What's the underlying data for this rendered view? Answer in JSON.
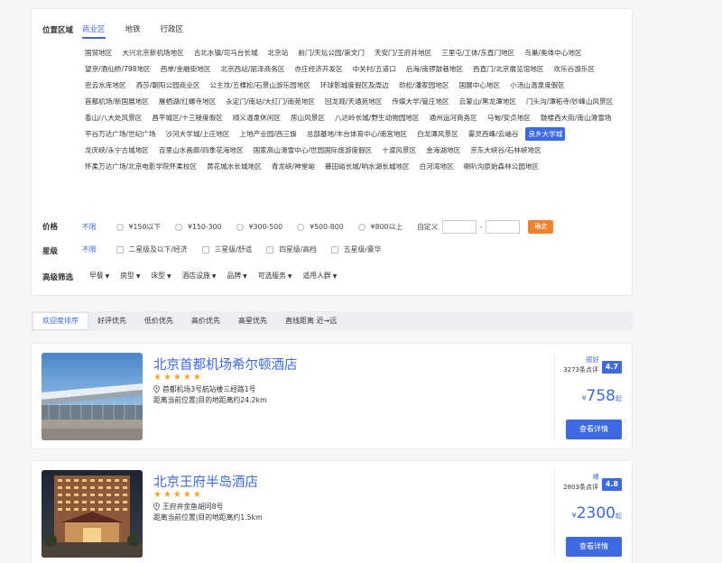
{
  "filters": {
    "location_label": "位置区域",
    "tabs": [
      "商业区",
      "地铁",
      "行政区"
    ],
    "areas": [
      "国贸地区",
      "大兴北京新机场地区",
      "古北水镇/司马台长城",
      "北京站",
      "前门/天坛公园/崇文门",
      "天安门/王府井地区",
      "三里屯/工体/东直门地区",
      "鸟巢/奥体中心地区",
      "望京/酒仙桥/798地区",
      "西单/金融街地区",
      "北京西站/丽泽商务区",
      "亦庄经济开发区",
      "中关村/五道口",
      "后海/南锣鼓巷地区",
      "西直门/北京展览馆地区",
      "欢乐谷游乐区",
      "密云水库地区",
      "燕莎/朝阳公园商业区",
      "公主坟/五棵松/石景山游乐园地区",
      "环球影城度假区及周边",
      "劲松/潘家园地区",
      "国展中心地区",
      "小汤山温泉度假区",
      "首都机场/新国展地区",
      "雁栖湖/红螺寺地区",
      "永定门/南站/大红门/南苑地区",
      "回龙观/天通苑地区",
      "传媒大学/管庄地区",
      "云蒙山/黑龙潭地区",
      "门头沟/潭柘寺/妙峰山风景区",
      "香山/八大处风景区",
      "昌平城区/十三陵度假区",
      "顺义温泉休闲区",
      "房山风景区",
      "八达岭长城/野生动物园地区",
      "通州运河商务区",
      "马甸/安贞地区",
      "鼓楼西大街/南山滑雪场",
      "平谷万达广场/世纪广场",
      "沙河大学城/上庄地区",
      "上地产业园/西三旗",
      "总部基地/丰台体育中心/南宫地区",
      "白龙潭风景区",
      "雾灵西峰/云岫谷",
      "良乡大学城",
      "龙庆峡/永宁古城地区",
      "百里山水画廊/四季花海地区",
      "国家高山滑雪中心/世园国际旅游度假区",
      "十渡风景区",
      "金海湖地区",
      "京东大峡谷/石林峡地区",
      "怀柔万达广场/北京电影学院怀柔校区",
      "黄花城水长城地区",
      "青龙峡/神堂峪",
      "慕田峪长城/响水湖长城地区",
      "白河湾地区",
      "喇叭沟原始森林公园地区"
    ],
    "active_area": "良乡大学城",
    "price_label": "价格",
    "price_nolimit": "不限",
    "price_options": [
      "¥150以下",
      "¥150-300",
      "¥300-500",
      "¥500-800",
      "¥800以上"
    ],
    "custom_label": "自定义",
    "custom_sep": "-",
    "confirm": "确定",
    "star_label": "星级",
    "star_nolimit": "不限",
    "star_options": [
      "二星级及以下/经济",
      "三星级/舒适",
      "四星级/高档",
      "五星级/豪华"
    ],
    "advanced_label": "高级筛选",
    "advanced_options": [
      "早餐",
      "房型",
      "床型",
      "酒店设施",
      "品牌",
      "可选服务",
      "适用人群"
    ]
  },
  "sort": {
    "items": [
      "欢迎度排序",
      "好评优先",
      "低价优先",
      "高价优先",
      "高星优先",
      "直线距离 近→远"
    ],
    "active": "欢迎度排序"
  },
  "hotels": [
    {
      "name": "北京首都机场希尔顿酒店",
      "stars": "★★★★★",
      "address": "首都机场3号航站楼三经路1号",
      "distance": "距离当前位置|目的地距离约24.2km",
      "rating_word": "很好",
      "reviews": "3273条点评",
      "score": "4.7",
      "currency": "¥",
      "price": "758",
      "price_suffix": "起",
      "button": "查看详情"
    },
    {
      "name": "北京王府半岛酒店",
      "stars": "★★★★★",
      "address": "王府井金鱼胡同8号",
      "distance": "距离当前位置|目的地距离约1.5km",
      "rating_word": "棒",
      "reviews": "2803条点评",
      "score": "4.8",
      "currency": "¥",
      "price": "2300",
      "price_suffix": "起",
      "button": "查看详情"
    }
  ],
  "colors": {
    "accent": "#3e6ae1",
    "star": "#f5a623",
    "confirm": "#f0822d"
  }
}
